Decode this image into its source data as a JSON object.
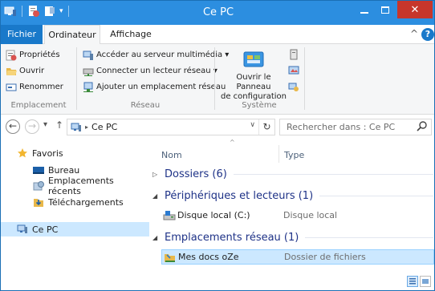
{
  "window": {
    "title": "Ce PC"
  },
  "tabs": [
    {
      "label": "Fichier"
    },
    {
      "label": "Ordinateur"
    },
    {
      "label": "Affichage"
    }
  ],
  "ribbon": {
    "emplacement": {
      "label": "Emplacement",
      "items": [
        "Propriétés",
        "Ouvrir",
        "Renommer"
      ]
    },
    "reseau": {
      "label": "Réseau",
      "items": [
        "Accéder au serveur multimédia ▾",
        "Connecter un lecteur réseau ▾",
        "Ajouter un emplacement réseau"
      ]
    },
    "systeme": {
      "label": "Système",
      "panel_line1": "Ouvrir le Panneau",
      "panel_line2": "de configuration"
    }
  },
  "address": {
    "path_label": "Ce PC",
    "search_placeholder": "Rechercher dans : Ce PC"
  },
  "nav": {
    "favoris": "Favoris",
    "bureau": "Bureau",
    "recents": "Emplacements récents",
    "telech": "Téléchargements",
    "cepc": "Ce PC"
  },
  "content": {
    "col_name": "Nom",
    "col_type": "Type",
    "groups": [
      {
        "label": "Dossiers (6)"
      },
      {
        "label": "Périphériques et lecteurs (1)"
      },
      {
        "label": "Emplacements réseau (1)"
      }
    ],
    "rows": [
      {
        "name": "Disque local (C:)",
        "type": "Disque local"
      },
      {
        "name": "Mes docs oZe",
        "type": "Dossier de fichiers"
      }
    ]
  },
  "colors": {
    "titlebar": "#2c8ee0",
    "file_tab": "#1979ca",
    "close": "#c7362b",
    "selection": "#cce8ff",
    "group_text": "#1e3287"
  }
}
